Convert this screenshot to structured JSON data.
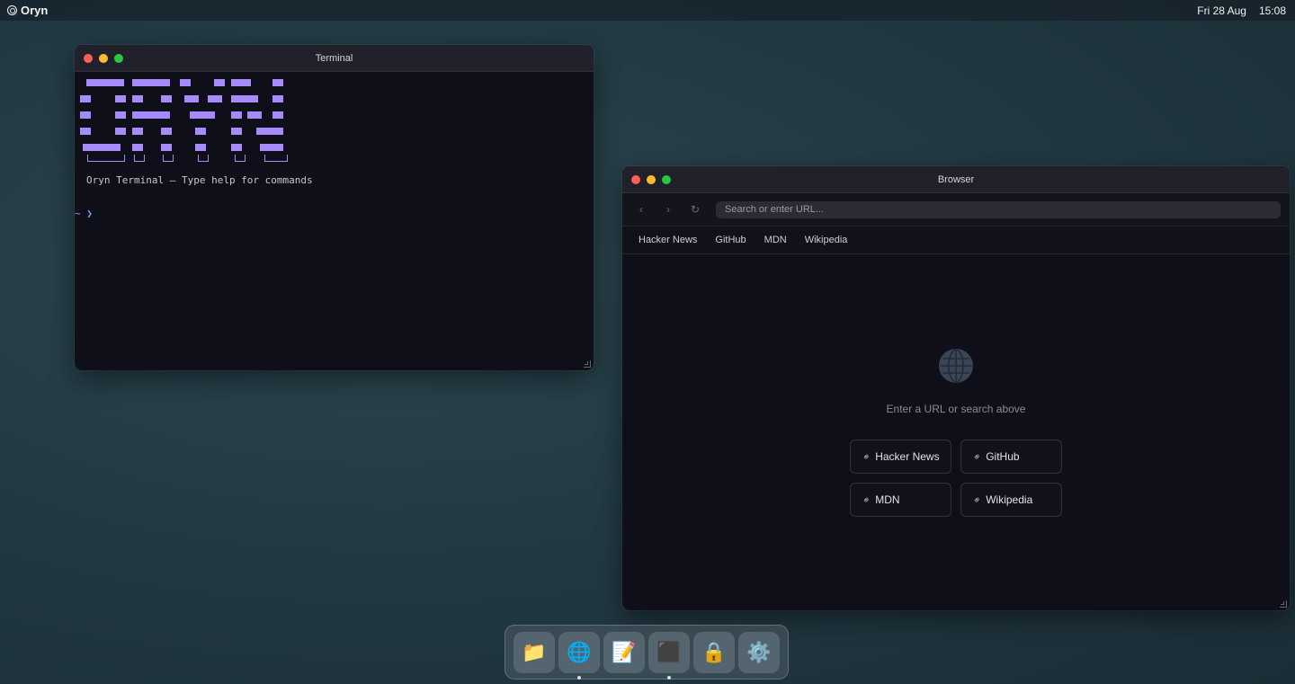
{
  "menubar": {
    "brand": "Oryn",
    "date": "Fri 28 Aug",
    "time": "15:08"
  },
  "terminal": {
    "title": "Terminal",
    "intro": "Oryn Terminal — Type help for commands",
    "prompt_path": "~",
    "prompt_symbol": "❯",
    "ascii_banner_text": "ORYN",
    "accent_color": "#a78bfa"
  },
  "browser": {
    "title": "Browser",
    "back_icon": "‹",
    "forward_icon": "›",
    "reload_icon": "↻",
    "search_placeholder": "Search or enter URL...",
    "bookmarks": [
      "Hacker News",
      "GitHub",
      "MDN",
      "Wikipedia"
    ],
    "empty_hint": "Enter a URL or search above",
    "quick_links": [
      "Hacker News",
      "GitHub",
      "MDN",
      "Wikipedia"
    ],
    "link_icon": "🔗"
  },
  "dock": {
    "items": [
      {
        "name": "files",
        "icon": "📁",
        "running": false
      },
      {
        "name": "browser",
        "icon": "🌐",
        "running": true
      },
      {
        "name": "notes",
        "icon": "📝",
        "running": false
      },
      {
        "name": "terminal",
        "icon": "⬛",
        "running": true
      },
      {
        "name": "lock",
        "icon": "🔒",
        "running": false
      },
      {
        "name": "settings",
        "icon": "⚙️",
        "running": false
      }
    ]
  }
}
